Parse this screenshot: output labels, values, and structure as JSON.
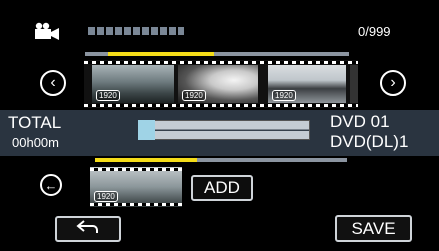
{
  "header": {
    "mode_icon": "video-camera-icon",
    "counter": "0/999"
  },
  "thumbnails": {
    "items": [
      {
        "badge": "1920"
      },
      {
        "badge": "1920"
      },
      {
        "badge": "1920"
      }
    ],
    "prev_icon": "chevron-left-circle-icon",
    "next_icon": "chevron-right-circle-icon"
  },
  "status": {
    "total_label": "TOTAL",
    "total_time": "00h00m",
    "disc_line1": "DVD  01",
    "disc_line2": "DVD(DL)1",
    "capacity_used_fraction": 0.1
  },
  "selection": {
    "back_icon": "arrow-left-circle-icon",
    "thumb_badge": "1920",
    "add_label": "ADD"
  },
  "footer": {
    "return_icon": "return-arrow-icon",
    "save_label": "SAVE"
  },
  "colors": {
    "progress": "#f4dc18",
    "band": "#2a3440",
    "capacity_fill": "#9fd3e6"
  }
}
